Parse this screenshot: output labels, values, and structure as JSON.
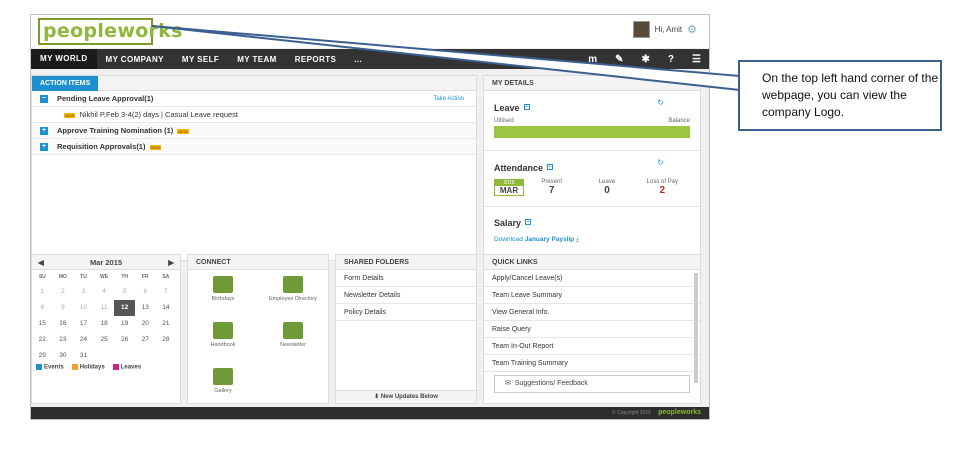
{
  "app": {
    "logo": "peopleworks"
  },
  "user": {
    "greeting": "Hi, Amit"
  },
  "nav": {
    "items": [
      "MY WORLD",
      "MY COMPANY",
      "MY SELF",
      "MY TEAM",
      "REPORTS",
      "..."
    ]
  },
  "action_items": {
    "title": "ACTION ITEMS",
    "take_action": "Take Action",
    "rows": [
      {
        "label": "Pending Leave Approval(1)",
        "toggle": "−"
      },
      {
        "label": "Nikhil P,Feb 3-4(2) days | Casual Leave request",
        "badge": "NEW"
      },
      {
        "label": "Approve Training Nomination (1)",
        "toggle": "+"
      },
      {
        "label": "Requisition Approvals(1)",
        "toggle": "+"
      }
    ]
  },
  "my_details": {
    "title": "MY DETAILS",
    "leave": {
      "title": "Leave",
      "utilised": "Utilised",
      "balance": "Balance"
    },
    "attendance": {
      "title": "Attendance",
      "year": "2015",
      "month": "MAR",
      "present_label": "Present",
      "present_value": "7",
      "leave_label": "Leave",
      "leave_value": "0",
      "lop_label": "Loss of Pay",
      "lop_value": "2"
    },
    "salary": {
      "title": "Salary",
      "download_prefix": "Download",
      "download_link": "January Payslip"
    }
  },
  "calendar": {
    "title": "Mar 2015",
    "days": [
      "SU",
      "MO",
      "TU",
      "WE",
      "TH",
      "FR",
      "SA"
    ],
    "weeks": [
      [
        "1",
        "2",
        "3",
        "4",
        "5",
        "6",
        "7"
      ],
      [
        "8",
        "9",
        "10",
        "11",
        "12",
        "13",
        "14"
      ],
      [
        "15",
        "16",
        "17",
        "18",
        "19",
        "20",
        "21"
      ],
      [
        "22",
        "23",
        "24",
        "25",
        "26",
        "27",
        "28"
      ],
      [
        "29",
        "30",
        "31",
        "",
        "",
        "",
        ""
      ]
    ],
    "legend": [
      "Events",
      "Holidays",
      "Leaves"
    ],
    "legend_colors": [
      "#1f90cf",
      "#f0a030",
      "#d02090"
    ]
  },
  "connect": {
    "title": "CONNECT",
    "items": [
      "Birthdays",
      "Employee Directory",
      "Handbook",
      "Newsletter",
      "Gallery"
    ]
  },
  "shared_folders": {
    "title": "SHARED FOLDERS",
    "items": [
      "Form Details",
      "Newsletter Details",
      "Policy Details"
    ],
    "updates": "New Updates Below"
  },
  "quick_links": {
    "title": "QUICK LINKS",
    "items": [
      "Apply/Cancel Leave(s)",
      "Team Leave Summary",
      "View General Info.",
      "Raise Query",
      "Team In-Out Report",
      "Team Training Summary"
    ],
    "feedback": "Suggestions/ Feedback"
  },
  "footer": {
    "copyright": "© Copyright 2015",
    "logo": "peopleworks"
  },
  "callout": {
    "text": "On the top left hand corner of the webpage, you can view the company Logo."
  },
  "colors": {
    "accent": "#1f90cf",
    "brand": "#8db83a",
    "nav": "#333333"
  }
}
